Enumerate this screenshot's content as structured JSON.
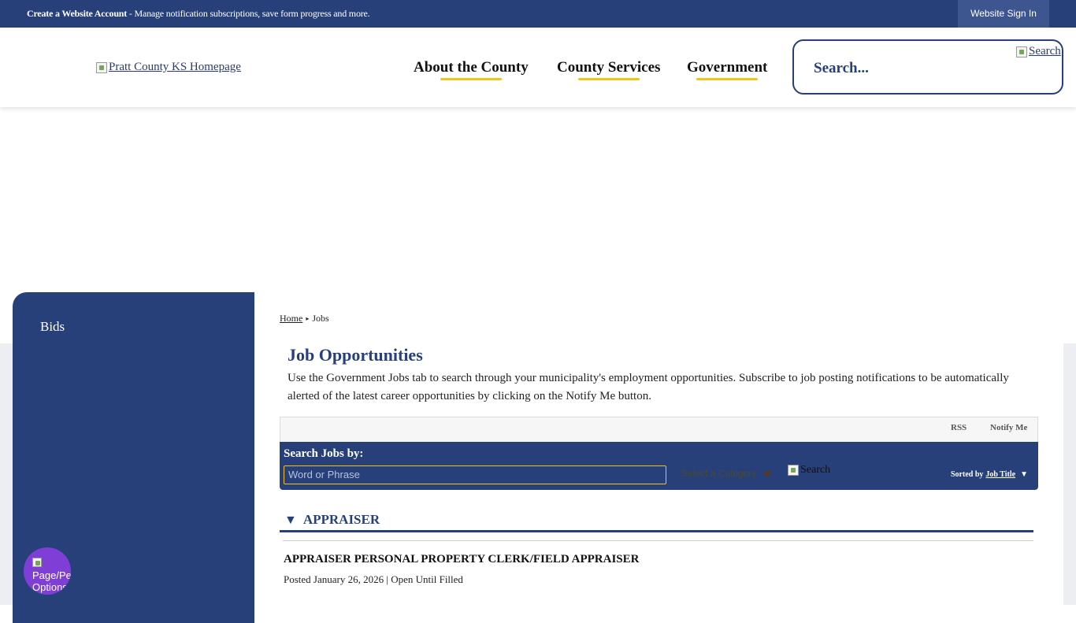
{
  "topbar": {
    "create_account": "Create a Website Account",
    "message": " - Manage notification subscriptions, save form progress and more.",
    "sign_in": "Website Sign In"
  },
  "header": {
    "logo_alt": "Pratt County KS Homepage",
    "nav": [
      "About the County",
      "County Services",
      "Government"
    ],
    "search_placeholder": "Search...",
    "search_button_alt": "Search",
    "accent_color": "#f0c419",
    "brand_color": "#27407a"
  },
  "sidebar": {
    "items": [
      "Bids"
    ]
  },
  "main": {
    "breadcrumb": {
      "home": "Home",
      "current": "Jobs"
    },
    "title": "Job Opportunities",
    "intro": "Use the Government Jobs tab to search through your municipality's employment opportunities. Subscribe to job posting notifications to be automatically alerted of the latest career opportunities by clicking on the Notify Me button.",
    "toolbar": {
      "rss": "RSS",
      "notify": "Notify Me"
    },
    "search_jobs": {
      "label": "Search Jobs by:",
      "word_placeholder": "Word or Phrase",
      "category_placeholder": "Select a Category",
      "search_button_alt": "Search",
      "sorted_by": "Sorted by",
      "sort_key": "Job Title"
    },
    "categories": [
      {
        "name": "APPRAISER",
        "jobs": [
          {
            "title": "APPRAISER PERSONAL PROPERTY CLERK/FIELD APPRAISER",
            "posted": "Posted January 26, 2026 | Open Until Filled"
          }
        ]
      }
    ]
  },
  "page_options": {
    "alt": "Page/Personal Options"
  }
}
